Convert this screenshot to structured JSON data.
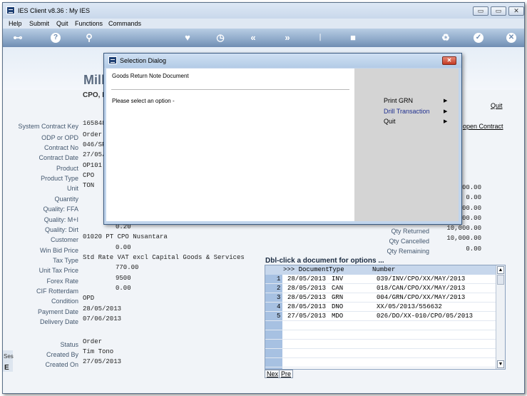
{
  "window": {
    "title": "IES Client v8.36 : My IES",
    "min_glyph": "▭",
    "max_glyph": "▭",
    "close_glyph": "✕"
  },
  "menu": [
    "Help",
    "Submit",
    "Quit",
    "Functions",
    "Commands"
  ],
  "banner": {
    "title_fragment": "Mill",
    "subtitle_fragment": "CPO, K"
  },
  "links": {
    "quit": "Quit",
    "open_contract": "open Contract"
  },
  "fields": [
    {
      "label": "System Contract Key",
      "value": "165848"
    },
    {
      "label": "ODP or OPD",
      "value": "Order."
    },
    {
      "label": "Contract No",
      "value": "046/SP"
    },
    {
      "label": "Contract Date",
      "value": "27/05/"
    },
    {
      "label": "Product",
      "value": "OP101"
    },
    {
      "label": "Product Type",
      "value": "CPO"
    },
    {
      "label": "Unit",
      "value": "TON"
    },
    {
      "label": "Quantity",
      "value": ""
    },
    {
      "label": "Quality: FFA",
      "value": ""
    },
    {
      "label": "Quality: M+I",
      "value": ""
    },
    {
      "label": "Quality: Dirt",
      "value": "0.20"
    },
    {
      "label": "Customer",
      "value": "01020 PT CPO Nusantara"
    },
    {
      "label": "Win Bid Price",
      "value": "0.00"
    },
    {
      "label": "Tax Type",
      "value": "Std Rate VAT excl Capital Goods & Services"
    },
    {
      "label": "Unit Tax Price",
      "value": "770.00"
    },
    {
      "label": "Forex Rate",
      "value": "9500"
    },
    {
      "label": "CIF Rotterdam",
      "value": "0.00"
    },
    {
      "label": "Condition",
      "value": "OPD"
    },
    {
      "label": "Payment Date",
      "value": "28/05/2013"
    },
    {
      "label": "Delivery Date",
      "value": "07/06/2013"
    }
  ],
  "footer_fields": [
    {
      "label": "Status",
      "value": "Order"
    },
    {
      "label": "Created By",
      "value": "Tim Tono"
    },
    {
      "label": "Created On",
      "value": "27/05/2013"
    }
  ],
  "right_values": [
    "00.00",
    "0.00",
    "00.00",
    "00.00"
  ],
  "qty": [
    {
      "label": "Qty Returned",
      "value": "10,000.00"
    },
    {
      "label": "Qty Cancelled",
      "value": "10,000.00"
    },
    {
      "label": "Qty Remaining",
      "value": "0.00"
    }
  ],
  "grid": {
    "caption": "Dbl-click a document for options ...",
    "header": {
      "doc": ">>> Document",
      "type": "Type",
      "number": "Number"
    },
    "rows": [
      {
        "n": "1",
        "date": "28/05/2013",
        "type": "INV",
        "number": "039/INV/CPO/XX/MAY/2013"
      },
      {
        "n": "2",
        "date": "28/05/2013",
        "type": "CAN",
        "number": "018/CAN/CPO/XX/MAY/2013"
      },
      {
        "n": "3",
        "date": "28/05/2013",
        "type": "GRN",
        "number": "004/GRN/CPO/XX/MAY/2013"
      },
      {
        "n": "4",
        "date": "28/05/2013",
        "type": "DNO",
        "number": "XX/05/2013/556632"
      },
      {
        "n": "5",
        "date": "27/05/2013",
        "type": "MDO",
        "number": "026/DO/XX-010/CPO/05/2013"
      }
    ],
    "nav": {
      "next": "Nex",
      "prev": "Pre"
    }
  },
  "side_fragments": {
    "ses": "Ses",
    "e": "E"
  },
  "dialog": {
    "title": "Selection Dialog",
    "heading": "Goods Return Note Document",
    "prompt": "Please select an option -",
    "close_glyph": "✕",
    "options": [
      {
        "label": "Print GRN",
        "color": "#000000"
      },
      {
        "label": "Drill Transaction",
        "color": "#1f2f8f"
      },
      {
        "label": "Quit",
        "color": "#000000"
      }
    ]
  }
}
